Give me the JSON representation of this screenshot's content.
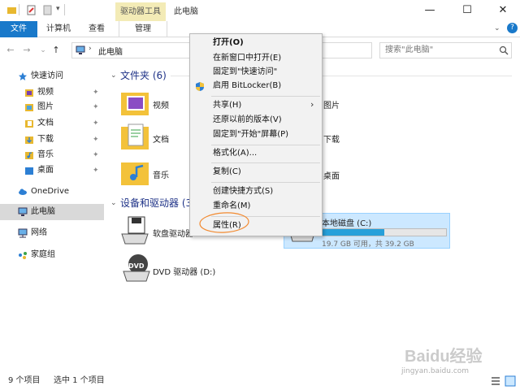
{
  "titlebar": {
    "tool_tab": "驱动器工具",
    "title": "此电脑",
    "minimize": "—",
    "maximize": "☐",
    "close": "✕"
  },
  "ribbon": {
    "tabs": [
      "文件",
      "计算机",
      "查看",
      "管理"
    ]
  },
  "navbar": {
    "back": "←",
    "forward": "→",
    "recent": "⌄",
    "up": "↑",
    "breadcrumb": "此电脑",
    "search_placeholder": "搜索\"此电脑\""
  },
  "sidebar": {
    "items": [
      {
        "label": "快速访问",
        "icon": "star-icon"
      },
      {
        "label": "视频",
        "icon": "video-folder-icon",
        "pinned": true
      },
      {
        "label": "图片",
        "icon": "pictures-folder-icon",
        "pinned": true
      },
      {
        "label": "文档",
        "icon": "documents-folder-icon",
        "pinned": true
      },
      {
        "label": "下载",
        "icon": "downloads-folder-icon",
        "pinned": true
      },
      {
        "label": "音乐",
        "icon": "music-folder-icon",
        "pinned": true
      },
      {
        "label": "桌面",
        "icon": "desktop-folder-icon",
        "pinned": true
      },
      {
        "label": "OneDrive",
        "icon": "cloud-icon"
      },
      {
        "label": "此电脑",
        "icon": "computer-icon"
      },
      {
        "label": "网络",
        "icon": "network-icon"
      },
      {
        "label": "家庭组",
        "icon": "homegroup-icon"
      }
    ],
    "pin_glyph": "📌"
  },
  "content": {
    "folders_header": "文件夹 (6)",
    "folders": [
      {
        "label": "视频",
        "col": 0
      },
      {
        "label": "图片",
        "col": 1
      },
      {
        "label": "文档",
        "col": 0
      },
      {
        "label": "下载",
        "col": 1
      },
      {
        "label": "音乐",
        "col": 0
      },
      {
        "label": "桌面",
        "col": 1
      }
    ],
    "devices_header": "设备和驱动器 (3",
    "floppy": "软盘驱动器",
    "local_disk_label": "本地磁盘 (C:)",
    "local_disk_free": "19.7 GB 可用，共 39.2 GB",
    "local_disk_used_fraction": 0.4974,
    "dvd_label": "DVD 驱动器 (D:)",
    "dvd_badge": "DVD"
  },
  "context_menu": {
    "items": [
      "打开(O)",
      "在新窗口中打开(E)",
      "固定到\"快速访问\"",
      "启用 BitLocker(B)",
      "共享(H)",
      "还原以前的版本(V)",
      "固定到\"开始\"屏幕(P)",
      "格式化(A)...",
      "复制(C)",
      "创建快捷方式(S)",
      "重命名(M)",
      "属性(R)"
    ],
    "submenu_arrow": "›"
  },
  "status": {
    "count": "9 个项目",
    "selected": "选中 1 个项目"
  },
  "watermark": {
    "text": "Baidu经验",
    "url": "jingyan.baidu.com"
  },
  "colors": {
    "accent": "#1979ca",
    "tool_tab_bg": "#f3ebb6",
    "folder": "#f3c23a",
    "disk_bar": "#26a0da",
    "circle": "#f28a30"
  }
}
